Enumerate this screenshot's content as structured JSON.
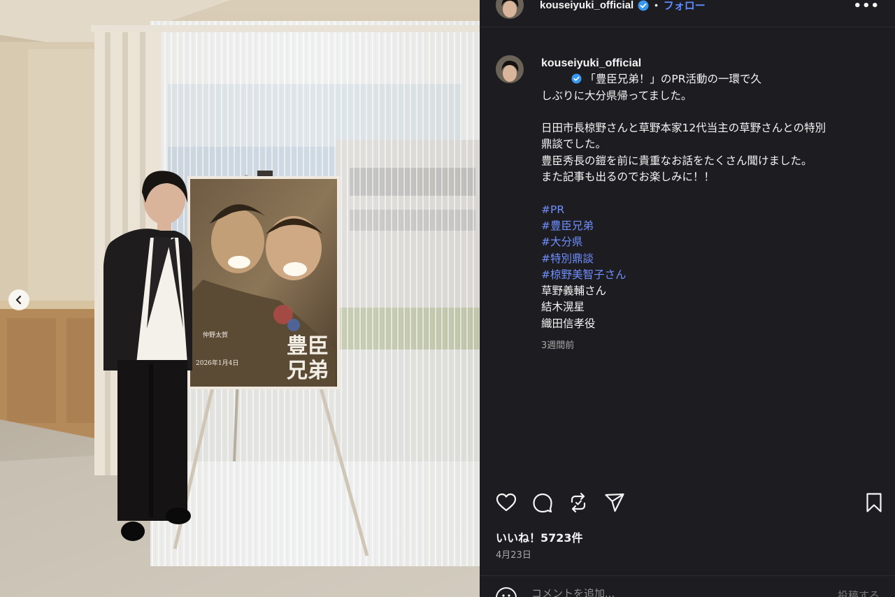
{
  "header": {
    "username": "kouseiyuki_official",
    "separator": "•",
    "follow_label": "フォロー",
    "more_label": "•••"
  },
  "caption": {
    "username": "kouseiyuki_official",
    "lines": [
      "「豊臣兄弟！」のPR活動の一環で久",
      "しぶりに大分県帰ってました。",
      "",
      "日田市長椋野さんと草野本家12代当主の草野さんとの特別",
      "鼎談でした。",
      "豊臣秀長の鎧を前に貴重なお話をたくさん聞けました。",
      "また記事も出るのでお楽しみに！！",
      ""
    ],
    "hashtags": [
      "#PR",
      "#豊臣兄弟",
      "#大分県",
      "#特別鼎談",
      "#椋野美智子さん"
    ],
    "plain_lines": [
      "草野義輔さん",
      "結木滉星",
      "織田信孝役"
    ],
    "time_ago": "3週間前"
  },
  "poster": {
    "title_line1": "豊臣",
    "title_line2": "兄弟",
    "cast_name": "仲野太賀",
    "release": "2026年1月4日"
  },
  "icons": {
    "like": "heart-icon",
    "comment": "comment-icon",
    "repost": "repost-icon",
    "share": "share-icon",
    "save": "bookmark-icon",
    "prev": "chevron-left-icon",
    "verified": "verified-badge-icon",
    "emoji": "emoji-icon"
  },
  "stats": {
    "likes": "いいね！5723件",
    "date": "4月23日"
  },
  "comment_box": {
    "placeholder": "コメントを追加...",
    "post_label": "投稿する"
  },
  "colors": {
    "panel_bg": "#1d1d21",
    "link_blue": "#5e8bff",
    "hashtag_blue": "#6f8fff",
    "verified_blue": "#3897f0"
  }
}
